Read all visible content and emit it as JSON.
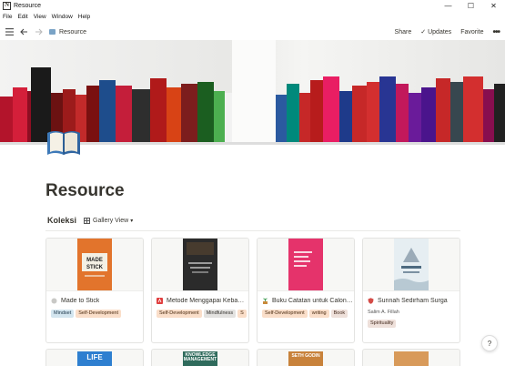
{
  "window": {
    "title": "Resource",
    "minimize": "—",
    "maximize": "☐",
    "close": "✕"
  },
  "menubar": {
    "items": [
      "File",
      "Edit",
      "View",
      "Window",
      "Help"
    ]
  },
  "topnav": {
    "breadcrumb": "Resource",
    "share": "Share",
    "updates": "Updates",
    "favorite": "Favorite"
  },
  "page": {
    "title": "Resource",
    "icon": "open-book-icon"
  },
  "database": {
    "title": "Koleksi",
    "view_label": "Gallery View",
    "cards": [
      {
        "title": "Made to Stick",
        "icon": "circle-icon",
        "cover_color": "#e2742c",
        "cover_text": "MADE TO STICK",
        "tags": [
          {
            "label": "Mindset",
            "color": "blue"
          },
          {
            "label": "Self-Development",
            "color": "orange"
          }
        ]
      },
      {
        "title": "Metode Menggapai Kebahagiaan",
        "icon": "red-square-icon",
        "cover_color": "#3a3a3a",
        "cover_text": "metode menggapai kebahagiaan",
        "tags": [
          {
            "label": "Self-Development",
            "color": "orange"
          },
          {
            "label": "Mindfulness",
            "color": "gray"
          },
          {
            "label": "S",
            "color": "orange"
          }
        ]
      },
      {
        "title": "Buku Catatan untuk Calon Penulis",
        "icon": "plant-icon",
        "cover_color": "#e5336b",
        "cover_text": "Buku Catatan untuk Calon Penulis",
        "tags": [
          {
            "label": "Self-Development",
            "color": "orange"
          },
          {
            "label": "writing",
            "color": "orange"
          },
          {
            "label": "Book",
            "color": "brown"
          }
        ]
      },
      {
        "title": "Sunnah Sedirham Surga",
        "icon": "shield-icon",
        "cover_color": "#d9e4ea",
        "cover_text": "Sunnah Sedirham Surga",
        "author": "Salim A. Fillah",
        "tags": [
          {
            "label": "Spirituality",
            "color": "brown"
          }
        ]
      }
    ],
    "partial_cards": [
      {
        "cover_color": "#2e7fd0",
        "label": "LIFE"
      },
      {
        "cover_color": "#2f6b5c",
        "label": "KNOWLEDGE MANAGEMENT"
      },
      {
        "cover_color": "#c8823b",
        "label": "SETH GODIN"
      },
      {
        "cover_color": "#d89a5a",
        "label": ""
      }
    ]
  },
  "help": {
    "label": "?"
  },
  "colors": {
    "text": "#37352f",
    "border": "#e3e3e1"
  }
}
